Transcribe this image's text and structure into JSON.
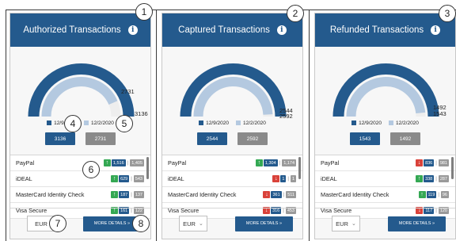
{
  "currency_options": [
    "EUR"
  ],
  "legend": {
    "current": "12/9/2020",
    "previous": "12/2/2020"
  },
  "more_details_label": "MORE DETAILS »",
  "cards": [
    {
      "title": "Authorized Transactions",
      "gauge": {
        "outer_value": 3136,
        "inner_value": 2731,
        "outer_label": "3136",
        "inner_label": "2731"
      },
      "totals": {
        "current": "3136",
        "previous": "2731"
      },
      "methods": [
        {
          "name": "PayPal",
          "trend": "up",
          "current": "1,516",
          "previous": "1,405"
        },
        {
          "name": "iDEAL",
          "trend": "up",
          "current": "629",
          "previous": "543"
        },
        {
          "name": "MasterCard Identity Check",
          "trend": "up",
          "current": "187",
          "previous": "137"
        },
        {
          "name": "Visa Secure",
          "trend": "up",
          "current": "161",
          "previous": "122"
        }
      ],
      "currency": "EUR",
      "currency_has_chevron": false
    },
    {
      "title": "Captured Transactions",
      "gauge": {
        "outer_value": 2592,
        "inner_value": 2544,
        "outer_label": "2592",
        "inner_label": "2544"
      },
      "totals": {
        "current": "2544",
        "previous": "2592"
      },
      "methods": [
        {
          "name": "PayPal",
          "trend": "up",
          "current": "1,304",
          "previous": "1,174"
        },
        {
          "name": "iDEAL",
          "trend": "down",
          "current": "1",
          "previous": "1"
        },
        {
          "name": "MasterCard Identity Check",
          "trend": "down",
          "current": "361",
          "previous": "511"
        },
        {
          "name": "Visa Secure",
          "trend": "down",
          "current": "316",
          "previous": "453"
        }
      ],
      "currency": "EUR",
      "currency_has_chevron": true
    },
    {
      "title": "Refunded Transactions",
      "gauge": {
        "outer_value": 1543,
        "inner_value": 1492,
        "outer_label": "1543",
        "inner_label": "1492"
      },
      "totals": {
        "current": "1543",
        "previous": "1492"
      },
      "methods": [
        {
          "name": "PayPal",
          "trend": "down",
          "current": "836",
          "previous": "981"
        },
        {
          "name": "iDEAL",
          "trend": "up",
          "current": "338",
          "previous": "287"
        },
        {
          "name": "MasterCard Identity Check",
          "trend": "up",
          "current": "119",
          "previous": "96"
        },
        {
          "name": "Visa Secure",
          "trend": "down",
          "current": "117",
          "previous": "120"
        }
      ],
      "currency": "EUR",
      "currency_has_chevron": true
    }
  ],
  "markers": [
    "1",
    "2",
    "3",
    "4",
    "5",
    "6",
    "7",
    "8"
  ],
  "colors": {
    "primary": "#245a8d",
    "light": "#b4c9e0",
    "neutral": "#8a8a8a",
    "up": "#34a853",
    "down": "#d9423a"
  }
}
